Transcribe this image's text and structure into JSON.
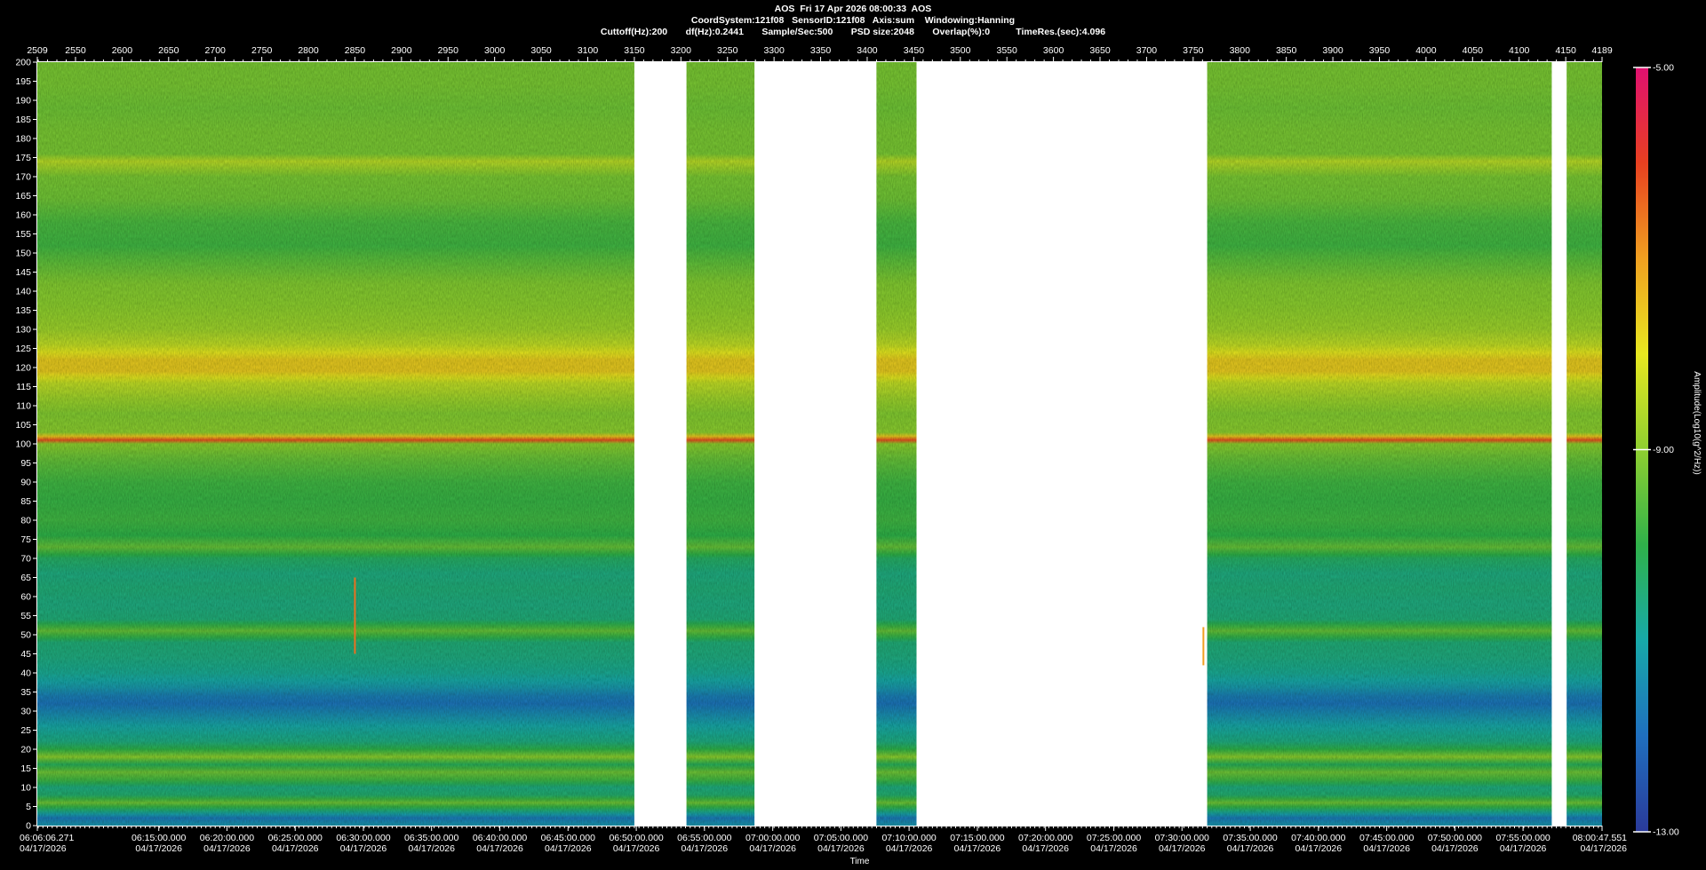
{
  "header": {
    "line1": "AOS  Fri 17 Apr 2026 08:00:33  AOS",
    "line2": "CoordSystem:121f08   SensorID:121f08   Axis:sum    Windowing:Hanning",
    "line3": "Cuttoff(Hz):200       df(Hz):0.2441       Sample/Sec:500       PSD size:2048       Overlap(%):0          TimeRes.(sec):4.096"
  },
  "chart_data": {
    "type": "heatmap",
    "title": "AOS  Fri 17 Apr 2026 08:00:33  AOS",
    "xlabel": "Time",
    "ylabel": "",
    "colorbar_label": "Amplitude(Log10(g^2/Hz))",
    "colorbar_ticks": [
      "-5.00",
      "-9.00",
      "-13.00"
    ],
    "colorbar_range": [
      -13,
      -5
    ],
    "colormap": [
      "#2a3a9a",
      "#1f6fbf",
      "#17a9a9",
      "#2fb24a",
      "#8fcf30",
      "#e8e820",
      "#f0a020",
      "#e84020",
      "#e01070"
    ],
    "ylim": [
      0,
      200
    ],
    "y_ticks": [
      0,
      5,
      10,
      15,
      20,
      25,
      30,
      35,
      40,
      45,
      50,
      55,
      60,
      65,
      70,
      75,
      80,
      85,
      90,
      95,
      100,
      105,
      110,
      115,
      120,
      125,
      130,
      135,
      140,
      145,
      150,
      155,
      160,
      165,
      170,
      175,
      180,
      185,
      190,
      195,
      200
    ],
    "xlim_index": [
      2509,
      4189
    ],
    "x_index_ticks": [
      {
        "label": "2509",
        "pos": 2509
      },
      {
        "label": "2550",
        "pos": 2550
      },
      {
        "label": "2600",
        "pos": 2600
      },
      {
        "label": "2650",
        "pos": 2650
      },
      {
        "label": "2700",
        "pos": 2700
      },
      {
        "label": "2750",
        "pos": 2750
      },
      {
        "label": "2800",
        "pos": 2800
      },
      {
        "label": "2850",
        "pos": 2850
      },
      {
        "label": "2900",
        "pos": 2900
      },
      {
        "label": "2950",
        "pos": 2950
      },
      {
        "label": "3000",
        "pos": 3000
      },
      {
        "label": "3050",
        "pos": 3050
      },
      {
        "label": "3100",
        "pos": 3100
      },
      {
        "label": "3150",
        "pos": 3150
      },
      {
        "label": "3200",
        "pos": 3200
      },
      {
        "label": "3250",
        "pos": 3250
      },
      {
        "label": "3300",
        "pos": 3300
      },
      {
        "label": "3350",
        "pos": 3350
      },
      {
        "label": "3400",
        "pos": 3400
      },
      {
        "label": "3450",
        "pos": 3450
      },
      {
        "label": "3500",
        "pos": 3500
      },
      {
        "label": "3550",
        "pos": 3550
      },
      {
        "label": "3600",
        "pos": 3600
      },
      {
        "label": "3650",
        "pos": 3650
      },
      {
        "label": "3700",
        "pos": 3700
      },
      {
        "label": "3750",
        "pos": 3750
      },
      {
        "label": "3800",
        "pos": 3800
      },
      {
        "label": "3850",
        "pos": 3850
      },
      {
        "label": "3900",
        "pos": 3900
      },
      {
        "label": "3950",
        "pos": 3950
      },
      {
        "label": "4000",
        "pos": 4000
      },
      {
        "label": "4050",
        "pos": 4050
      },
      {
        "label": "4100",
        "pos": 4100
      },
      {
        "label": "4150",
        "pos": 4150
      },
      {
        "label": "4189",
        "pos": 4189
      }
    ],
    "x_time_ticks": [
      {
        "time": "06:06:06.271",
        "date": "04/17/2026",
        "pos": 2509
      },
      {
        "time": "06:15:00.000",
        "date": "04/17/2026",
        "pos": 2639.4
      },
      {
        "time": "06:20:00.000",
        "date": "04/17/2026",
        "pos": 2712.6
      },
      {
        "time": "06:25:00.000",
        "date": "04/17/2026",
        "pos": 2785.9
      },
      {
        "time": "06:30:00.000",
        "date": "04/17/2026",
        "pos": 2859.1
      },
      {
        "time": "06:35:00.000",
        "date": "04/17/2026",
        "pos": 2932.3
      },
      {
        "time": "06:40:00.000",
        "date": "04/17/2026",
        "pos": 3005.6
      },
      {
        "time": "06:45:00.000",
        "date": "04/17/2026",
        "pos": 3078.8
      },
      {
        "time": "06:50:00.000",
        "date": "04/17/2026",
        "pos": 3152.1
      },
      {
        "time": "06:55:00.000",
        "date": "04/17/2026",
        "pos": 3225.3
      },
      {
        "time": "07:00:00.000",
        "date": "04/17/2026",
        "pos": 3298.6
      },
      {
        "time": "07:05:00.000",
        "date": "04/17/2026",
        "pos": 3371.8
      },
      {
        "time": "07:10:00.000",
        "date": "04/17/2026",
        "pos": 3445.0
      },
      {
        "time": "07:15:00.000",
        "date": "04/17/2026",
        "pos": 3518.3
      },
      {
        "time": "07:20:00.000",
        "date": "04/17/2026",
        "pos": 3591.5
      },
      {
        "time": "07:25:00.000",
        "date": "04/17/2026",
        "pos": 3664.8
      },
      {
        "time": "07:30:00.000",
        "date": "04/17/2026",
        "pos": 3738.0
      },
      {
        "time": "07:35:00.000",
        "date": "04/17/2026",
        "pos": 3811.3
      },
      {
        "time": "07:40:00.000",
        "date": "04/17/2026",
        "pos": 3884.5
      },
      {
        "time": "07:45:00.000",
        "date": "04/17/2026",
        "pos": 3957.8
      },
      {
        "time": "07:50:00.000",
        "date": "04/17/2026",
        "pos": 4031.0
      },
      {
        "time": "07:55:00.000",
        "date": "04/17/2026",
        "pos": 4104.2
      },
      {
        "time": "08:00:47.551",
        "date": "04/17/2026",
        "pos": 4189
      }
    ],
    "data_segments": [
      [
        2509,
        3150
      ],
      [
        3206,
        3279
      ],
      [
        3410,
        3453
      ],
      [
        3765,
        4135
      ],
      [
        4151,
        4189
      ]
    ],
    "frequency_profile": [
      {
        "hz": 0,
        "level": -11.3
      },
      {
        "hz": 2,
        "level": -11.8
      },
      {
        "hz": 4,
        "level": -10.5
      },
      {
        "hz": 6,
        "level": -9.3
      },
      {
        "hz": 8,
        "level": -10.4
      },
      {
        "hz": 10,
        "level": -10.6
      },
      {
        "hz": 12,
        "level": -9.8
      },
      {
        "hz": 14,
        "level": -9.3
      },
      {
        "hz": 16,
        "level": -10.2
      },
      {
        "hz": 18,
        "level": -9.0
      },
      {
        "hz": 20,
        "level": -10.0
      },
      {
        "hz": 22,
        "level": -10.6
      },
      {
        "hz": 24,
        "level": -10.8
      },
      {
        "hz": 26,
        "level": -11.0
      },
      {
        "hz": 28,
        "level": -11.3
      },
      {
        "hz": 30,
        "level": -11.6
      },
      {
        "hz": 32,
        "level": -11.9
      },
      {
        "hz": 34,
        "level": -11.7
      },
      {
        "hz": 36,
        "level": -11.3
      },
      {
        "hz": 38,
        "level": -11.0
      },
      {
        "hz": 40,
        "level": -10.8
      },
      {
        "hz": 44,
        "level": -10.6
      },
      {
        "hz": 48,
        "level": -10.5
      },
      {
        "hz": 51,
        "level": -9.4
      },
      {
        "hz": 54,
        "level": -10.5
      },
      {
        "hz": 58,
        "level": -10.6
      },
      {
        "hz": 62,
        "level": -10.5
      },
      {
        "hz": 66,
        "level": -10.6
      },
      {
        "hz": 70,
        "level": -10.3
      },
      {
        "hz": 73,
        "level": -9.4
      },
      {
        "hz": 76,
        "level": -10.0
      },
      {
        "hz": 80,
        "level": -9.8
      },
      {
        "hz": 85,
        "level": -9.9
      },
      {
        "hz": 90,
        "level": -9.8
      },
      {
        "hz": 96,
        "level": -9.4
      },
      {
        "hz": 100,
        "level": -9.0
      },
      {
        "hz": 101,
        "level": -6.2
      },
      {
        "hz": 103,
        "level": -9.0
      },
      {
        "hz": 108,
        "level": -9.1
      },
      {
        "hz": 112,
        "level": -8.8
      },
      {
        "hz": 116,
        "level": -8.4
      },
      {
        "hz": 119,
        "level": -7.6
      },
      {
        "hz": 122,
        "level": -7.6
      },
      {
        "hz": 126,
        "level": -8.4
      },
      {
        "hz": 130,
        "level": -8.8
      },
      {
        "hz": 136,
        "level": -9.0
      },
      {
        "hz": 142,
        "level": -9.1
      },
      {
        "hz": 148,
        "level": -9.5
      },
      {
        "hz": 152,
        "level": -9.8
      },
      {
        "hz": 158,
        "level": -9.7
      },
      {
        "hz": 164,
        "level": -9.3
      },
      {
        "hz": 170,
        "level": -9.2
      },
      {
        "hz": 174,
        "level": -8.5
      },
      {
        "hz": 176,
        "level": -9.2
      },
      {
        "hz": 182,
        "level": -9.2
      },
      {
        "hz": 188,
        "level": -9.3
      },
      {
        "hz": 194,
        "level": -9.2
      },
      {
        "hz": 200,
        "level": -9.2
      }
    ],
    "events": [
      {
        "label": "",
        "index": 2850,
        "hz_range": [
          45,
          65
        ],
        "level": -6.5
      },
      {
        "label": "",
        "index": 3761,
        "hz_range": [
          42,
          52
        ],
        "level": -7.0
      }
    ],
    "grid": false,
    "legend": "right colorbar"
  }
}
